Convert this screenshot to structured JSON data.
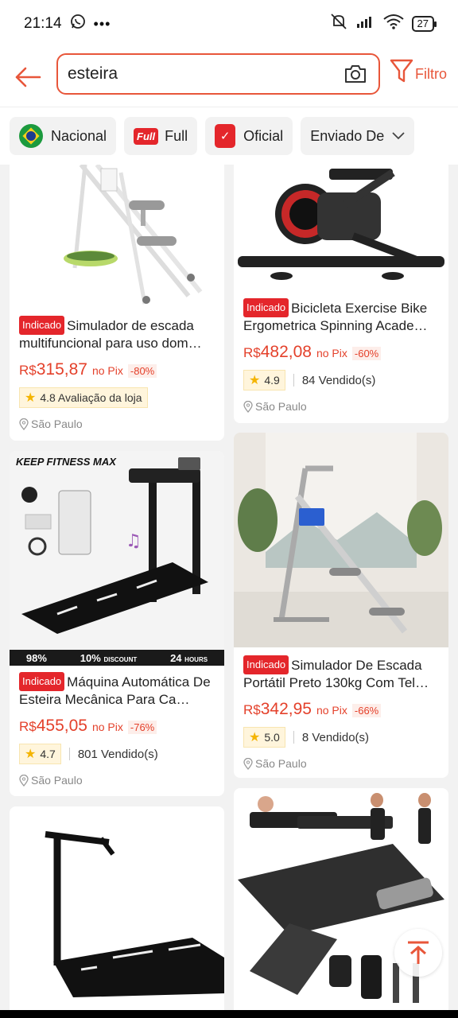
{
  "status_bar": {
    "time": "21:14",
    "battery": "27"
  },
  "search": {
    "query": "esteira",
    "filter_label": "Filtro"
  },
  "filter_chips": [
    {
      "label": "Nacional",
      "icon": "brazil-flag-icon"
    },
    {
      "label": "Full",
      "badge": "Full",
      "icon": "full-badge-icon"
    },
    {
      "label": "Oficial",
      "icon": "official-store-icon"
    },
    {
      "label": "Enviado De",
      "icon": "chevron-down-icon"
    }
  ],
  "products": [
    {
      "tag": "Indicado",
      "title": "Simulador de escada multifuncional para uso dom…",
      "currency": "R$",
      "price": "315,87",
      "pix": "no Pix",
      "discount": "-80%",
      "rating": "4.8 Avaliação da loja",
      "location": "São Paulo"
    },
    {
      "tag": "Indicado",
      "title": "Bicicleta Exercise Bike Ergometrica Spinning Acade…",
      "currency": "R$",
      "price": "482,08",
      "pix": "no Pix",
      "discount": "-60%",
      "rating": "4.9",
      "sold": "84 Vendido(s)",
      "location": "São Paulo"
    },
    {
      "tag": "Indicado",
      "title": "Máquina Automática De Esteira Mecânica Para Ca…",
      "currency": "R$",
      "price": "455,05",
      "pix": "no Pix",
      "discount": "-76%",
      "rating": "4.7",
      "sold": "801 Vendido(s)",
      "location": "São Paulo"
    },
    {
      "tag": "Indicado",
      "title": "Simulador De Escada Portátil Preto 130kg Com Tel…",
      "currency": "R$",
      "price": "342,95",
      "pix": "no Pix",
      "discount": "-66%",
      "rating": "5.0",
      "sold": "8 Vendido(s)",
      "location": "São Paulo"
    },
    {
      "title": ""
    },
    {
      "title": ""
    }
  ],
  "banner": {
    "brand": "KEEP FITNESS MAX",
    "stat1": "98%",
    "stat2": "10%",
    "stat2_label": "DISCOUNT",
    "stat3": "24",
    "stat3_label": "HOURS"
  }
}
